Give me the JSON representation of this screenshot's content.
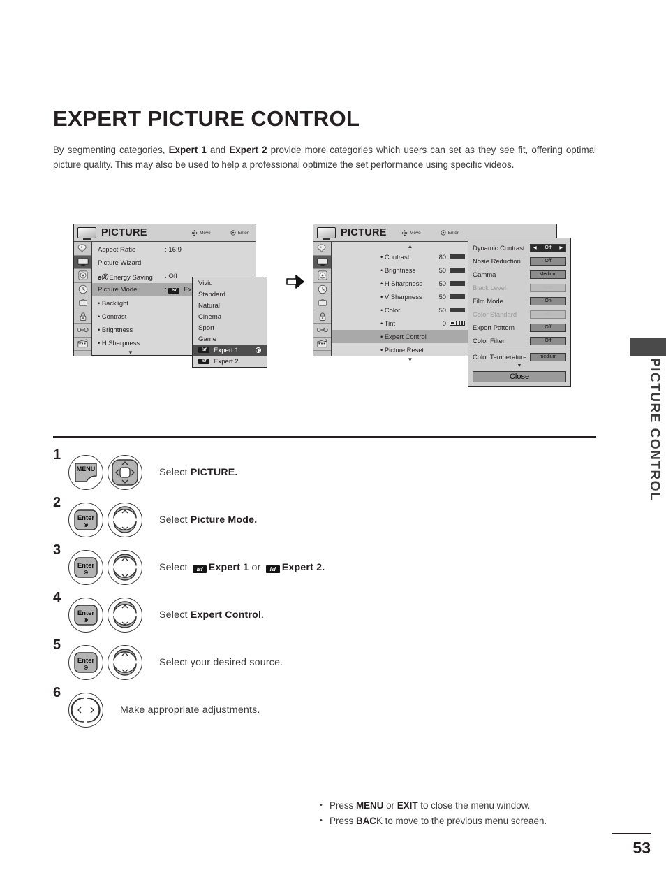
{
  "page": {
    "title": "EXPERT PICTURE CONTROL",
    "intro_parts": [
      {
        "t": "By segmenting categories, ",
        "b": false
      },
      {
        "t": "Expert 1",
        "b": true
      },
      {
        "t": " and ",
        "b": false
      },
      {
        "t": "Expert 2",
        "b": true
      },
      {
        "t": " provide more categories which users can set as they see fit, offering optimal picture quality. This may also be used to help a professional optimize the set performance using specific videos.",
        "b": false
      }
    ],
    "side_tab_text": "PICTURE CONTROL",
    "page_number": "53"
  },
  "osd1": {
    "title": "PICTURE",
    "hint_move": "Move",
    "hint_enter": "Enter",
    "rows": [
      {
        "label": "Aspect Ratio",
        "value": ": 16:9",
        "highlight": false
      },
      {
        "label": "Picture Wizard",
        "value": "",
        "highlight": false
      },
      {
        "label": "Energy Saving",
        "value": ": Off",
        "highlight": false,
        "leading_icon": "energy-saving-icon"
      },
      {
        "label": "Picture Mode",
        "value": ": Expert 1",
        "highlight": true,
        "badge": "isf"
      }
    ],
    "sub_rows": [
      "• Backlight",
      "• Contrast",
      "• Brightness",
      "• H Sharpness"
    ],
    "scroll_down": "▼",
    "mode_popup": {
      "items": [
        {
          "label": "Vivid",
          "badge": false,
          "selected": false
        },
        {
          "label": "Standard",
          "badge": false,
          "selected": false
        },
        {
          "label": "Natural",
          "badge": false,
          "selected": false
        },
        {
          "label": "Cinema",
          "badge": false,
          "selected": false
        },
        {
          "label": "Sport",
          "badge": false,
          "selected": false
        },
        {
          "label": "Game",
          "badge": false,
          "selected": false
        },
        {
          "label": "Expert 1",
          "badge": true,
          "selected": true
        },
        {
          "label": "Expert 2",
          "badge": true,
          "selected": false
        }
      ],
      "badge_text": "isf"
    }
  },
  "osd2": {
    "title": "PICTURE",
    "hint_move": "Move",
    "hint_enter": "Enter",
    "scroll_up": "▲",
    "scroll_down": "▼",
    "rows": [
      {
        "label": "• Contrast",
        "value": "80",
        "bar": true,
        "highlight": false
      },
      {
        "label": "• Brightness",
        "value": "50",
        "bar": true,
        "highlight": false
      },
      {
        "label": "• H Sharpness",
        "value": "50",
        "bar": true,
        "highlight": false
      },
      {
        "label": "• V Sharpness",
        "value": "50",
        "bar": true,
        "highlight": false
      },
      {
        "label": "• Color",
        "value": "50",
        "bar": true,
        "highlight": false
      },
      {
        "label": "• Tint",
        "value": "0",
        "bar": "tint",
        "highlight": false
      },
      {
        "label": "• Expert Control",
        "value": "",
        "bar": false,
        "highlight": true
      },
      {
        "label": "• Picture Reset",
        "value": "",
        "bar": false,
        "highlight": false
      }
    ],
    "expert_panel": {
      "rows": [
        {
          "label": "Dynamic Contrast",
          "value": "Off",
          "style": "dark",
          "dim": false
        },
        {
          "label": "Nosie Reduction",
          "value": "Off",
          "style": "normal",
          "dim": false
        },
        {
          "label": "Gamma",
          "value": "Medium",
          "style": "normal",
          "dim": false
        },
        {
          "label": "Black Level",
          "value": "Auto",
          "style": "dim",
          "dim": true
        },
        {
          "label": "Film Mode",
          "value": "On",
          "style": "normal",
          "dim": false
        },
        {
          "label": "Color Standard",
          "value": "HD",
          "style": "dim",
          "dim": true
        },
        {
          "label": "Expert Pattern",
          "value": "Off",
          "style": "normal",
          "dim": false
        },
        {
          "label": "Color Filter",
          "value": "Off",
          "style": "normal",
          "dim": false
        }
      ],
      "temperature": {
        "label": "Color Temperature",
        "value": "medium"
      },
      "scroll_down": "▼",
      "close_label": "Close",
      "arrow_left": "◀",
      "arrow_right": "▶"
    }
  },
  "steps": [
    {
      "num": "1",
      "buttons": [
        "MENU",
        "dpad4"
      ],
      "text_parts": [
        {
          "t": "Select ",
          "b": false
        },
        {
          "t": "PICTURE.",
          "b": true
        }
      ]
    },
    {
      "num": "2",
      "buttons": [
        "Enter",
        "dpad-ud"
      ],
      "text_parts": [
        {
          "t": "Select ",
          "b": false
        },
        {
          "t": "Picture Mode.",
          "b": true
        }
      ]
    },
    {
      "num": "3",
      "buttons": [
        "Enter",
        "dpad-ud"
      ],
      "text_parts": [
        {
          "t": "Select ",
          "b": false
        },
        {
          "t": "isf",
          "b": "badge"
        },
        {
          "t": "Expert 1",
          "b": true
        },
        {
          "t": " or ",
          "b": false
        },
        {
          "t": "isf",
          "b": "badge"
        },
        {
          "t": "Expert 2.",
          "b": true
        }
      ]
    },
    {
      "num": "4",
      "buttons": [
        "Enter",
        "dpad-ud"
      ],
      "text_parts": [
        {
          "t": "Select ",
          "b": false
        },
        {
          "t": "Expert Control",
          "b": true
        },
        {
          "t": ".",
          "b": false
        }
      ]
    },
    {
      "num": "5",
      "buttons": [
        "Enter",
        "dpad-ud"
      ],
      "text_parts": [
        {
          "t": "Select your desired source.",
          "b": false
        }
      ]
    },
    {
      "num": "6",
      "buttons": [
        "dpad-lr"
      ],
      "text_parts": [
        {
          "t": "Make appropriate adjustments.",
          "b": false
        }
      ]
    }
  ],
  "notes": [
    [
      {
        "t": "Press ",
        "b": false
      },
      {
        "t": "MENU",
        "b": true
      },
      {
        "t": " or ",
        "b": false
      },
      {
        "t": "EXIT",
        "b": true
      },
      {
        "t": " to close the menu window.",
        "b": false
      }
    ],
    [
      {
        "t": "Press ",
        "b": false
      },
      {
        "t": "BAC",
        "b": true
      },
      {
        "t": "K to move to the previous menu screaen.",
        "b": false
      }
    ]
  ],
  "button_labels": {
    "menu": "MENU",
    "enter": "Enter"
  }
}
